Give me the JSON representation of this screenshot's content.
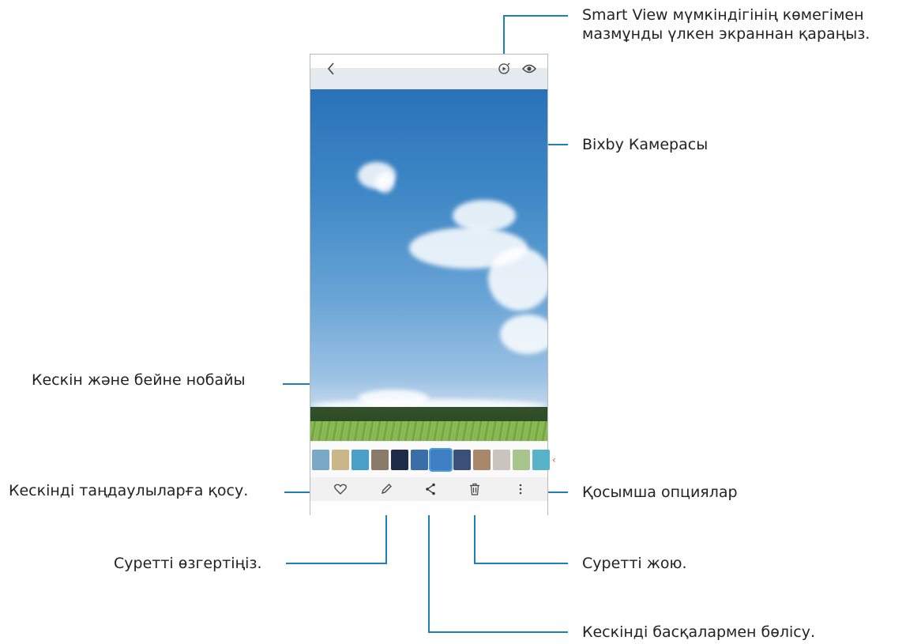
{
  "callouts": {
    "smart_view_line1": "Smart View мүмкіндігінің көмегімен",
    "smart_view_line2": "мазмұнды үлкен экраннан қараңыз.",
    "bixby": "Bixby Камерасы",
    "thumbnails": "Кескін және бейне нобайы",
    "favorite": "Кескінді таңдаулыларға қосу.",
    "more": "Қосымша опциялар",
    "edit": "Суретті өзгертіңіз.",
    "delete": "Суретті жою.",
    "share": "Кескінді басқалармен бөлісу."
  },
  "phone": {
    "top_icons": [
      "back-icon",
      "smart-view-icon",
      "bixby-vision-icon"
    ],
    "bottom_icons": [
      "heart-icon",
      "pencil-icon",
      "share-icon",
      "trash-icon",
      "more-icon"
    ],
    "thumbnails": [
      {
        "color": "#7aa9c8"
      },
      {
        "color": "#c9b78a"
      },
      {
        "color": "#4aa0c9"
      },
      {
        "color": "#8a7a6a"
      },
      {
        "color": "#1e2c4a"
      },
      {
        "color": "#3a6ea6"
      },
      {
        "color": "#3d7fc2",
        "selected": true
      },
      {
        "color": "#3c4f78"
      },
      {
        "color": "#a8876a"
      },
      {
        "color": "#c9c4bd"
      },
      {
        "color": "#a7c48c"
      },
      {
        "color": "#58b3c9"
      }
    ]
  },
  "colors": {
    "accent": "#1b7fb8"
  }
}
